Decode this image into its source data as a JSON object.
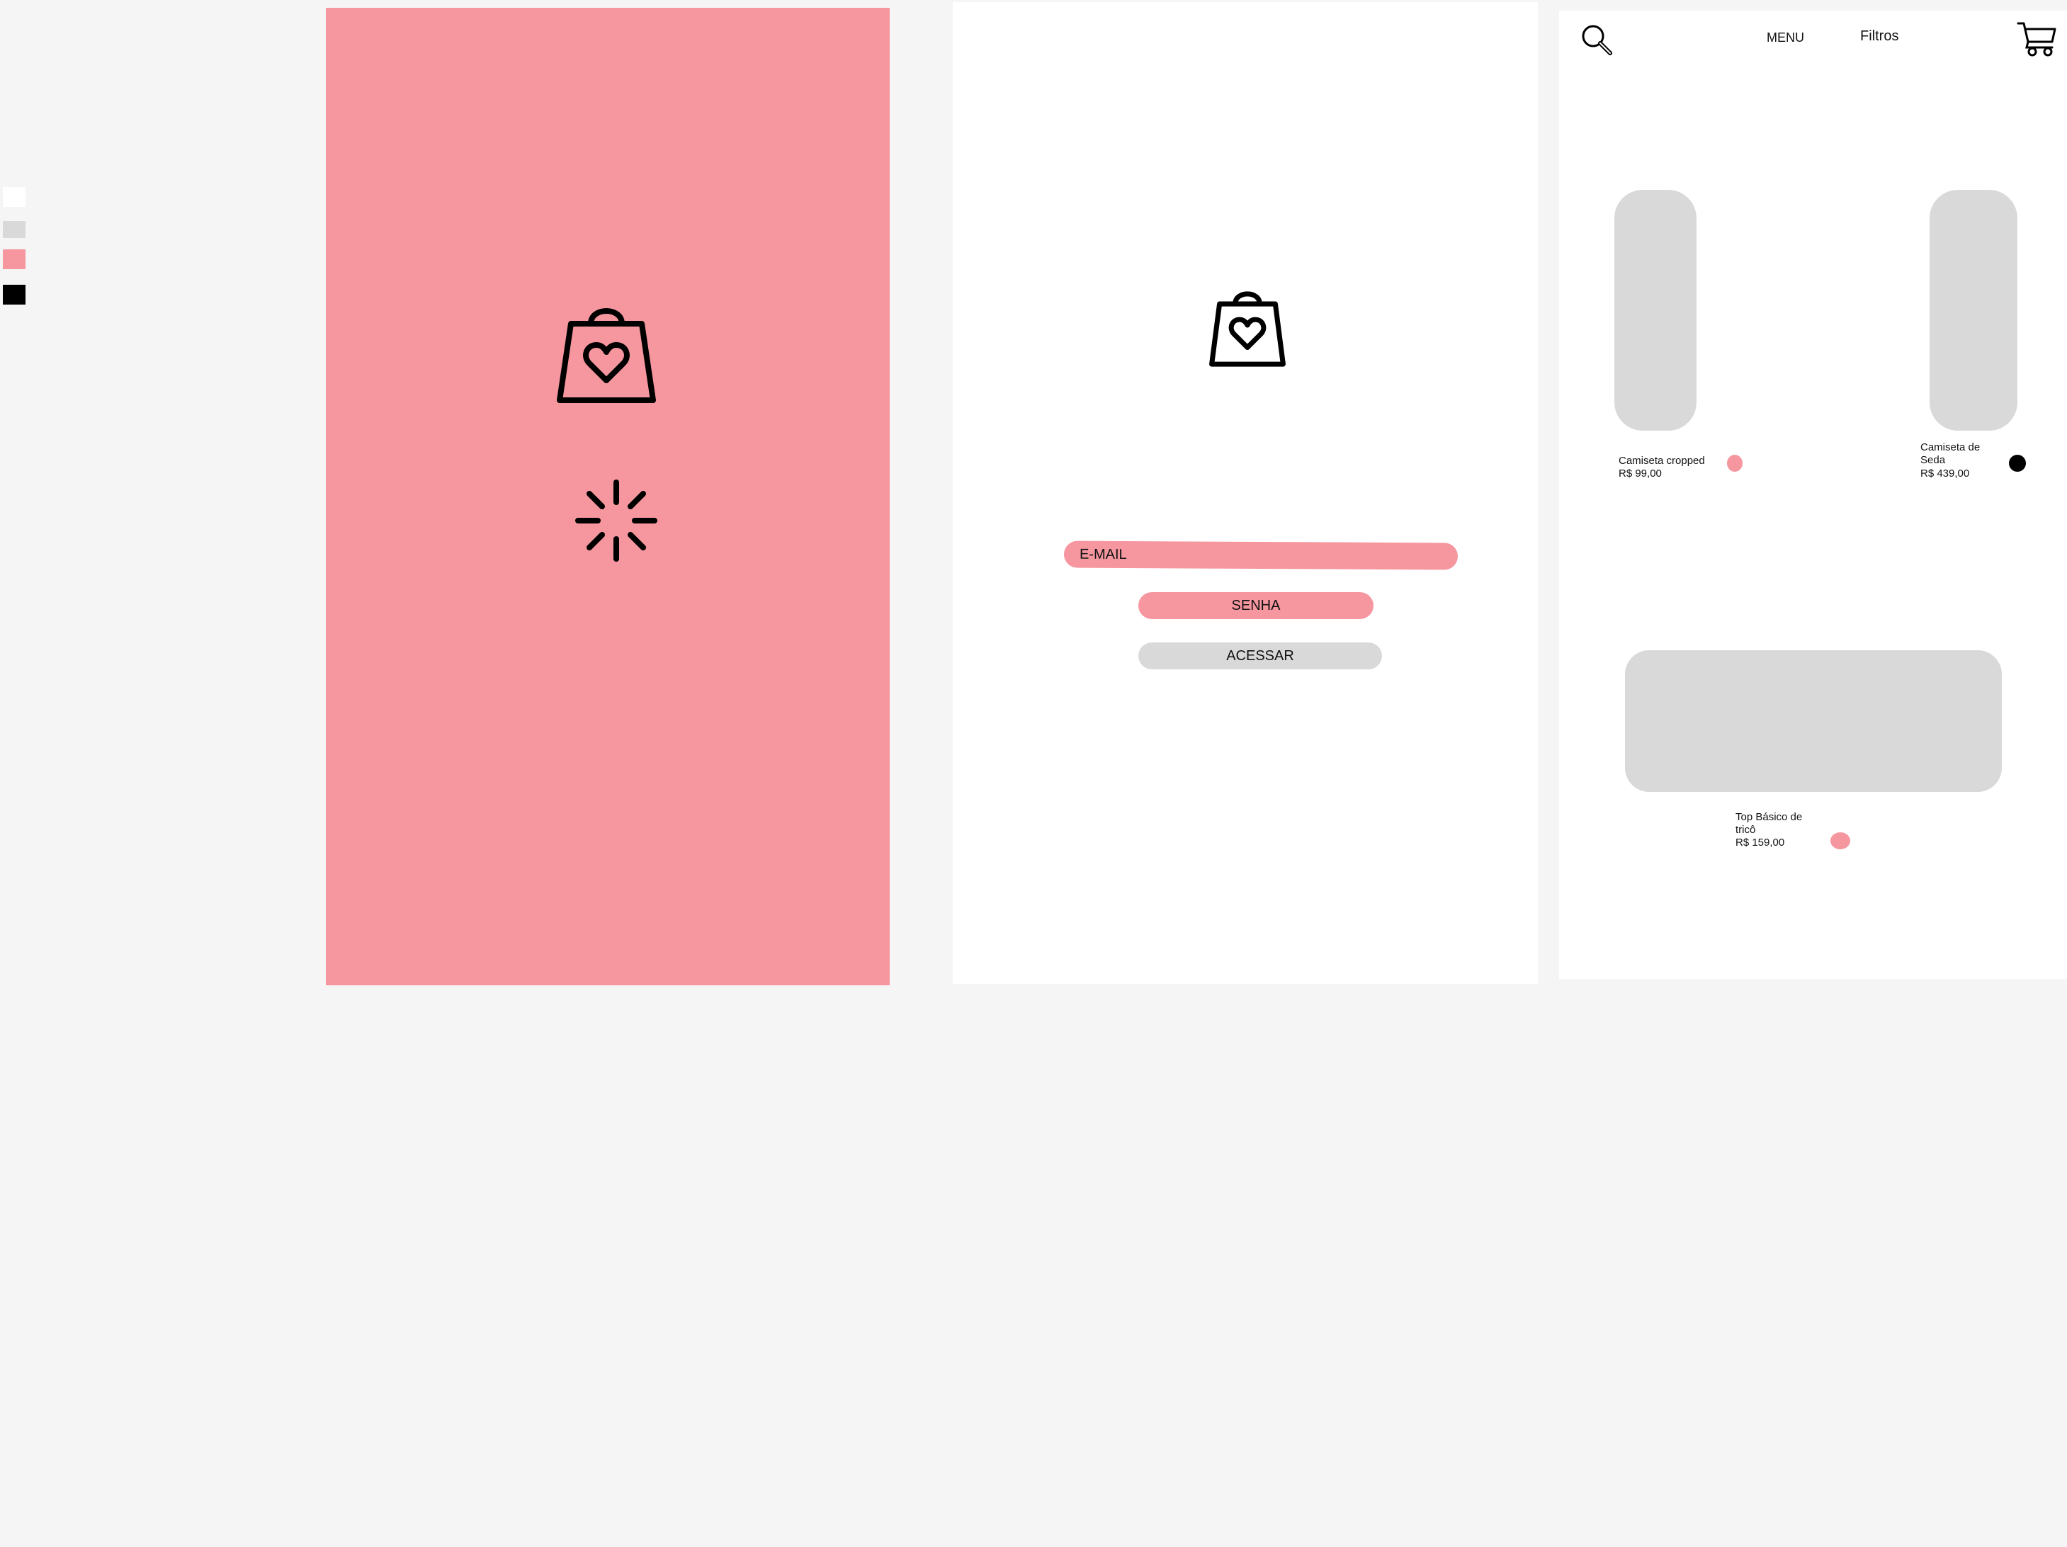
{
  "palette": {
    "white": "#ffffff",
    "light_gray": "#d9d9d9",
    "pink": "#f6969f",
    "black": "#000000"
  },
  "splash": {
    "logo_icon": "shopping-bag-heart-icon",
    "loader_icon": "loading-spinner-icon"
  },
  "login": {
    "logo_icon": "shopping-bag-heart-icon",
    "email_placeholder": "E-MAIL",
    "password_placeholder": "SENHA",
    "submit_label": "ACESSAR"
  },
  "catalog": {
    "header": {
      "search_icon": "search-icon",
      "menu_label": "MENU",
      "filters_label": "Filtros",
      "cart_icon": "cart-icon"
    },
    "products": [
      {
        "name": "Camiseta cropped",
        "price": "R$ 99,00",
        "color": "#f6969f"
      },
      {
        "name_line1": "Camiseta de",
        "name_line2": "Seda",
        "price": "R$ 439,00",
        "color": "#000000"
      },
      {
        "name_line1": "Top Básico de",
        "name_line2": "tricô",
        "price": "R$ 159,00",
        "color": "#f6969f"
      }
    ]
  }
}
